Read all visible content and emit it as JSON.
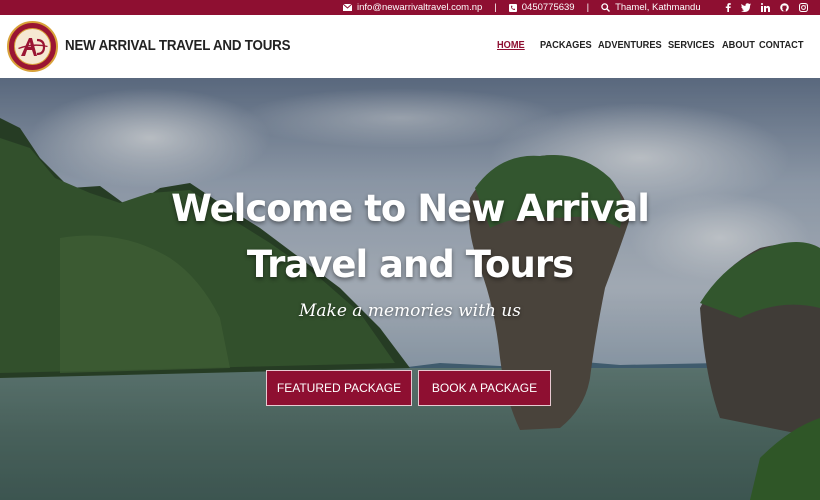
{
  "topbar": {
    "email": "info@newarrivaltravel.com.np",
    "phone": "0450775639",
    "location": "Thamel, Kathmandu",
    "separator": "|",
    "social_icons": [
      "facebook-icon",
      "twitter-icon",
      "linkedin-icon",
      "github-icon",
      "instagram-icon"
    ],
    "bg_color": "#8e0f31"
  },
  "header": {
    "brand": "NEW ARRIVAL TRAVEL AND TOURS",
    "nav": [
      {
        "label": "HOME",
        "active": true
      },
      {
        "label": "PACKAGES"
      },
      {
        "label": "ADVENTURES"
      },
      {
        "label": "SERVICES"
      },
      {
        "label": "ABOUT"
      },
      {
        "label": "CONTACT"
      }
    ]
  },
  "hero": {
    "title_line1": "Welcome to New Arrival",
    "title_line2": "Travel and Tours",
    "subtitle": "Make a memories with us",
    "buttons": {
      "featured": "FEATURED PACKAGE",
      "book": "BOOK A PACKAGE"
    }
  },
  "colors": {
    "accent": "#8e0f31",
    "active_nav": "#8e0f31"
  }
}
